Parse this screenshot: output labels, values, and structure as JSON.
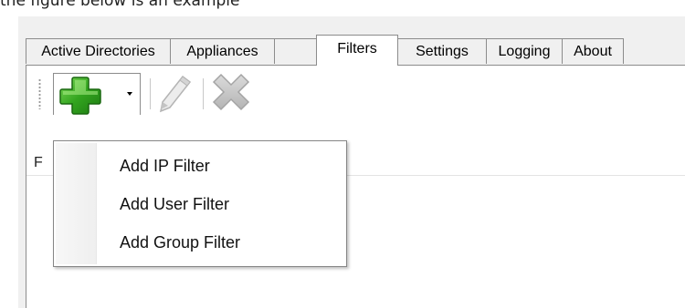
{
  "caption": "the figure below is an example",
  "tabs": [
    {
      "label": "Active Directories",
      "active": false
    },
    {
      "label": "Appliances",
      "active": false
    },
    {
      "label": "Filters",
      "active": true
    },
    {
      "label": "Settings",
      "active": false
    },
    {
      "label": "Logging",
      "active": false
    },
    {
      "label": "About",
      "active": false
    }
  ],
  "toolbar": {
    "add_icon": "green-plus-icon",
    "edit_icon": "pencil-icon",
    "delete_icon": "x-delete-icon",
    "add_color": "#2e9a1e",
    "disabled_color": "#bdbdbd"
  },
  "list": {
    "header_partial": "F"
  },
  "add_menu": {
    "items": [
      {
        "label": "Add IP Filter"
      },
      {
        "label": "Add User Filter"
      },
      {
        "label": "Add Group Filter"
      }
    ]
  }
}
